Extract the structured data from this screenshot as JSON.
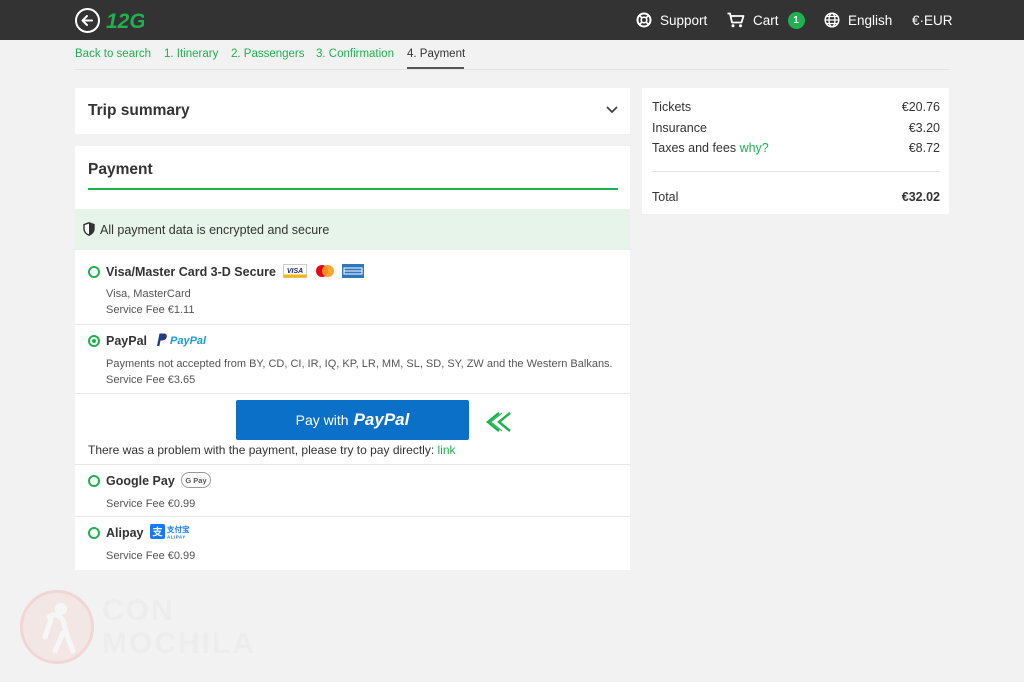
{
  "header": {
    "logo_text": "12Go",
    "support": "Support",
    "cart": "Cart",
    "cart_count": "1",
    "language": "English",
    "currency": "€·EUR"
  },
  "breadcrumbs": [
    {
      "label": "Back to search"
    },
    {
      "label": "1. Itinerary"
    },
    {
      "label": "2. Passengers"
    },
    {
      "label": "3. Confirmation"
    },
    {
      "label": "4. Payment"
    }
  ],
  "trip_summary": {
    "title": "Trip summary"
  },
  "payment": {
    "title": "Payment",
    "secure_text": "All payment data is encrypted and secure",
    "options": [
      {
        "label": "Visa/Master Card 3-D Secure",
        "sub1": "Visa, MasterCard",
        "sub2": "Service Fee €1.11",
        "selected": false
      },
      {
        "label": "PayPal",
        "sub1": "Payments not accepted from BY, CD, CI, IR, IQ, KP, LR, MM, SL, SD, SY, ZW and the Western Balkans.",
        "sub2": "Service Fee €3.65",
        "selected": true
      },
      {
        "label": "Google Pay",
        "sub2": "Service Fee €0.99",
        "selected": false
      },
      {
        "label": "Alipay",
        "sub2": "Service Fee €0.99",
        "selected": false
      }
    ],
    "paypal_button_prefix": "Pay with",
    "paypal_button_brand": "PayPal",
    "paypal_logo_text": "PayPal",
    "visa_text": "VISA",
    "gpay_text": "G Pay",
    "alipay_cn": "支付宝",
    "alipay_en": "ALIPAY",
    "problem_text": "There was a problem with the payment, please try to pay directly:",
    "problem_link": "link"
  },
  "summary": {
    "tickets_label": "Tickets",
    "tickets_value": "€20.76",
    "insurance_label": "Insurance",
    "insurance_value": "€3.20",
    "taxes_label": "Taxes and fees",
    "taxes_why": "why?",
    "taxes_value": "€8.72",
    "total_label": "Total",
    "total_value": "€32.02"
  },
  "watermark": {
    "line1": "CON",
    "line2": "MOCHILA"
  },
  "colors": {
    "accent": "#1fb14f",
    "topbar": "#333333",
    "paypal_blue": "#0b70c8"
  }
}
